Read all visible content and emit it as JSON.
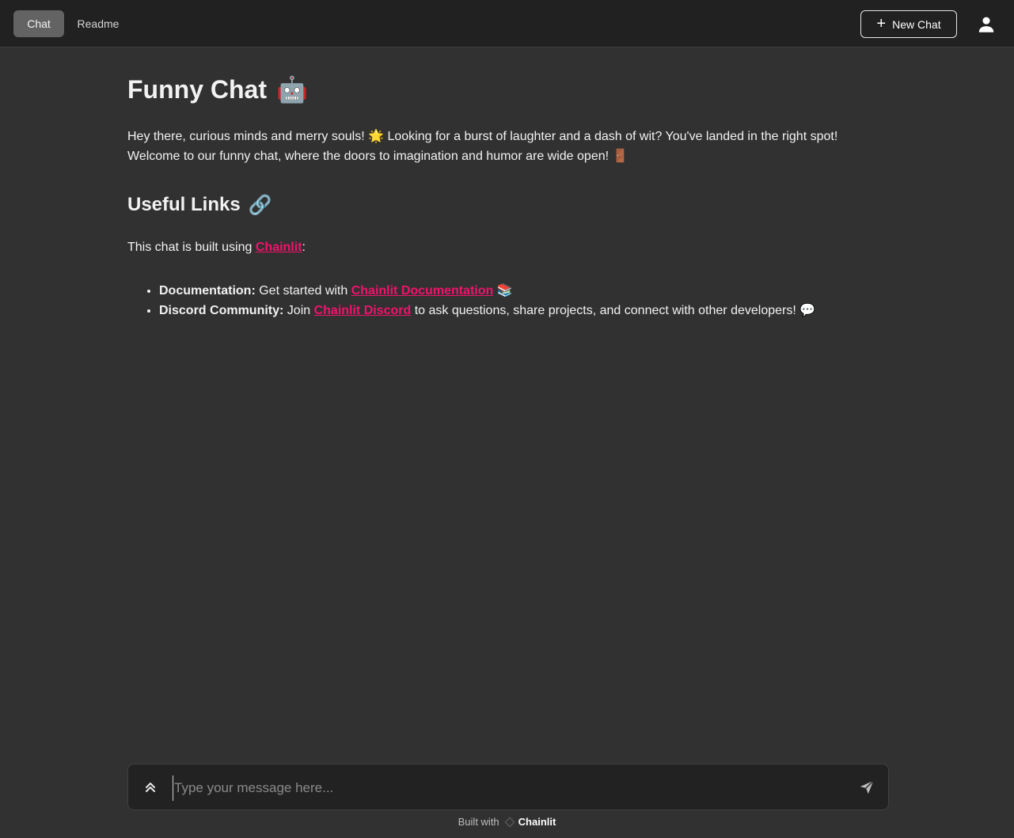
{
  "header": {
    "tabs": [
      {
        "label": "Chat",
        "active": true
      },
      {
        "label": "Readme",
        "active": false
      }
    ],
    "new_chat_label": "New Chat",
    "user_icon": "user-icon"
  },
  "main": {
    "title": "Funny Chat",
    "title_emoji": "🤖",
    "intro": "Hey there, curious minds and merry souls! 🌟 Looking for a burst of laughter and a dash of wit? You've landed in the right spot! Welcome to our funny chat, where the doors to imagination and humor are wide open! 🚪",
    "links_heading": "Useful Links",
    "links_heading_emoji": "🔗",
    "built_prefix": "This chat is built using ",
    "built_link": "Chainlit",
    "built_suffix": ":",
    "list": [
      {
        "bold": "Documentation:",
        "before": " Get started with ",
        "link": "Chainlit Documentation",
        "after": " 📚"
      },
      {
        "bold": "Discord Community:",
        "before": " Join ",
        "link": "Chainlit Discord",
        "after": " to ask questions, share projects, and connect with other developers! 💬"
      }
    ]
  },
  "composer": {
    "placeholder": "Type your message here..."
  },
  "footer": {
    "built_with": "Built with",
    "brand": "Chainlit"
  },
  "colors": {
    "accent": "#f0136c",
    "background": "#313131",
    "topbar": "#212121"
  }
}
